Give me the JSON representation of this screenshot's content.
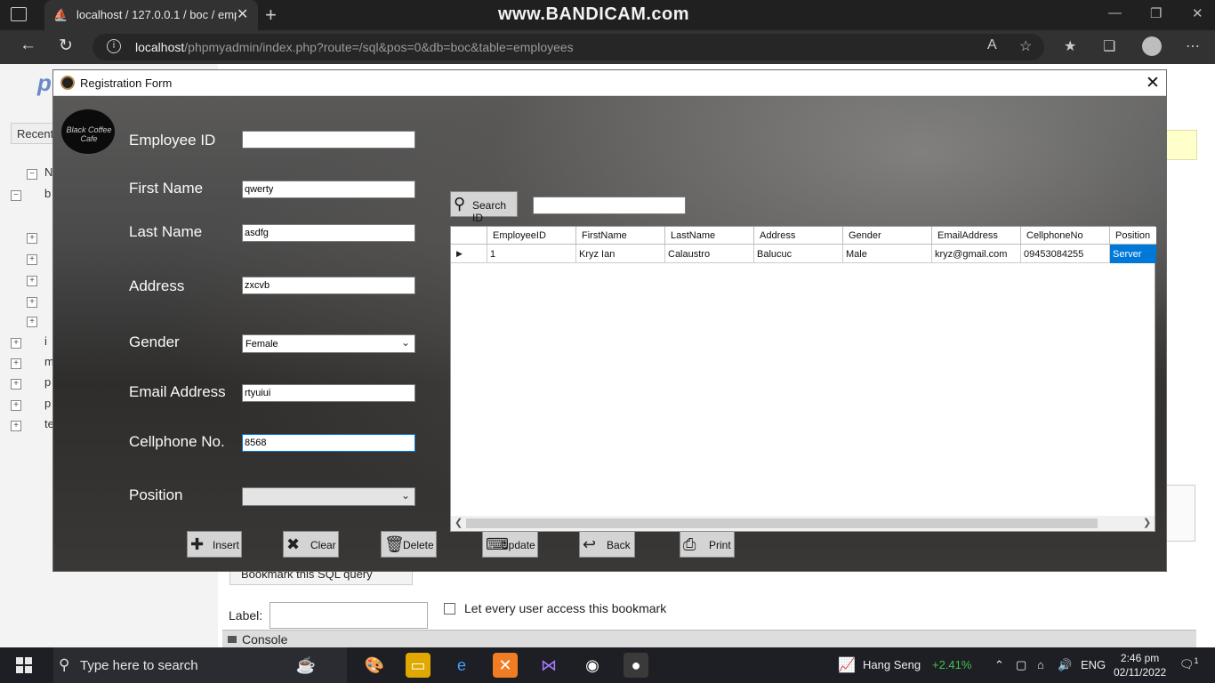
{
  "browser": {
    "tab_title": "localhost / 127.0.0.1 / boc / emp",
    "watermark": "www.BANDICAM.com",
    "url_host": "localhost",
    "url_path": "/phpmyadmin/index.php?route=/sql&pos=0&db=boc&table=employees"
  },
  "pma": {
    "logo": "p",
    "recent": "Recent",
    "tree": [
      "N",
      "b",
      "i",
      "m",
      "p",
      "p",
      "te"
    ],
    "bookmark_button": "Bookmark this SQL query",
    "label_label": "Label:",
    "checkbox_label": "Let every user access this bookmark",
    "console": "Console"
  },
  "dialog": {
    "title": "Registration Form",
    "logo_text": "Black Coffee Cafe",
    "labels": {
      "employee_id": "Employee ID",
      "first_name": "First Name",
      "last_name": "Last Name",
      "address": "Address",
      "gender": "Gender",
      "email": "Email Address",
      "cellphone": "Cellphone No.",
      "position": "Position"
    },
    "values": {
      "employee_id": "",
      "first_name": "qwerty",
      "last_name": "asdfg",
      "address": "zxcvb",
      "gender": "Female",
      "email": "rtyuiui",
      "cellphone": "8568",
      "position": ""
    },
    "search_button": "Search ID",
    "search_value": "",
    "buttons": {
      "insert": "Insert",
      "clear": "Clear",
      "delete": "Delete",
      "update": "Update",
      "back": "Back",
      "print": "Print"
    },
    "grid": {
      "columns": [
        "EmployeeID",
        "FirstName",
        "LastName",
        "Address",
        "Gender",
        "EmailAddress",
        "CellphoneNo",
        "Position"
      ],
      "rows": [
        [
          "1",
          "Kryz Ian",
          "Calaustro",
          "Balucuc",
          "Male",
          "kryz@gmail.com",
          "09453084255",
          "Server"
        ]
      ]
    }
  },
  "taskbar": {
    "search_placeholder": "Type here to search",
    "stock_name": "Hang Seng",
    "stock_change": "+2.41%",
    "lang": "ENG",
    "time": "2:46 pm",
    "date": "02/11/2022",
    "notifications": "1"
  }
}
